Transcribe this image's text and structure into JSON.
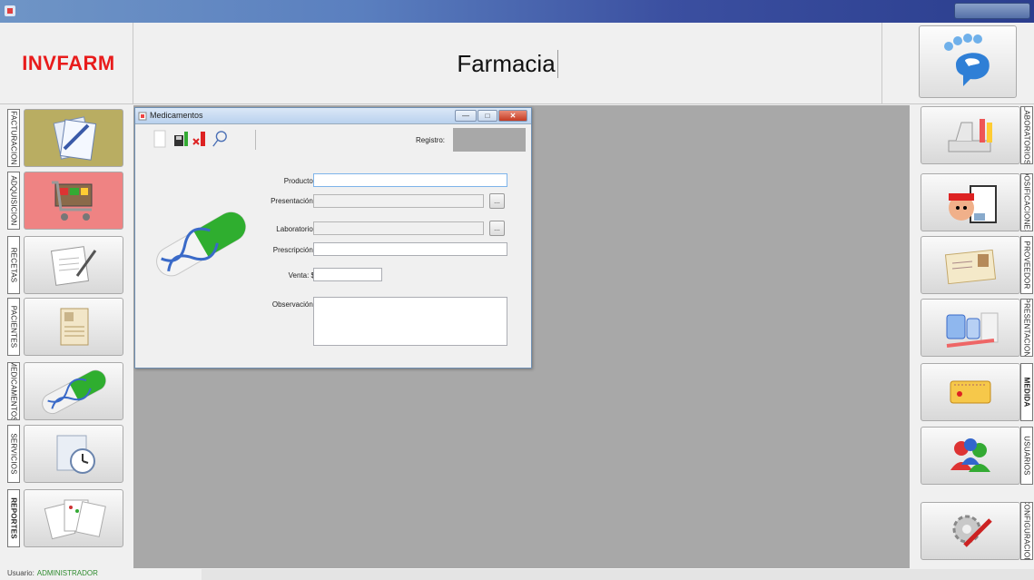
{
  "header": {
    "logo": "INVFARM",
    "title": "Farmacia"
  },
  "left_sidebar": [
    {
      "label": "FACTURACION",
      "icon": "invoice-documents-icon"
    },
    {
      "label": "ADQUISICION",
      "icon": "shopping-cart-icon"
    },
    {
      "label": "RECETAS",
      "icon": "prescription-pen-icon"
    },
    {
      "label": "PACIENTES",
      "icon": "patient-record-icon"
    },
    {
      "label": "MEDICAMENTOS",
      "icon": "pill-capsule-icon"
    },
    {
      "label": "SERVICIOS",
      "icon": "clock-service-icon"
    },
    {
      "label": "REPORTES",
      "icon": "reports-icon"
    }
  ],
  "right_sidebar": [
    {
      "label": "LABORATORIOS",
      "icon": "lab-microscope-icon"
    },
    {
      "label": "DOSIFICACIONES",
      "icon": "dosage-icon"
    },
    {
      "label": "PROVEEDOR",
      "icon": "supplier-id-card-icon"
    },
    {
      "label": "PRESENTACION",
      "icon": "medicine-presentation-icon"
    },
    {
      "label": "MEDIDA",
      "icon": "measure-ruler-icon"
    },
    {
      "label": "USUARIOS",
      "icon": "users-icon"
    },
    {
      "label": "CONFIGURACION",
      "icon": "settings-tools-icon"
    }
  ],
  "child_window": {
    "title": "Medicamentos",
    "registro_label": "Registro:",
    "fields": {
      "producto": {
        "label": "Producto:",
        "value": ""
      },
      "presentacion": {
        "label": "Presentación:",
        "value": ""
      },
      "laboratorio": {
        "label": "Laboratorio:",
        "value": ""
      },
      "prescripcion": {
        "label": "Prescripción:",
        "value": ""
      },
      "venta": {
        "label": "Venta: $",
        "value": ""
      },
      "observacion": {
        "label": "Observación:",
        "value": ""
      }
    },
    "browse_label": "..."
  },
  "status": {
    "user_label": "Usuario:",
    "user_value": "ADMINISTRADOR"
  }
}
